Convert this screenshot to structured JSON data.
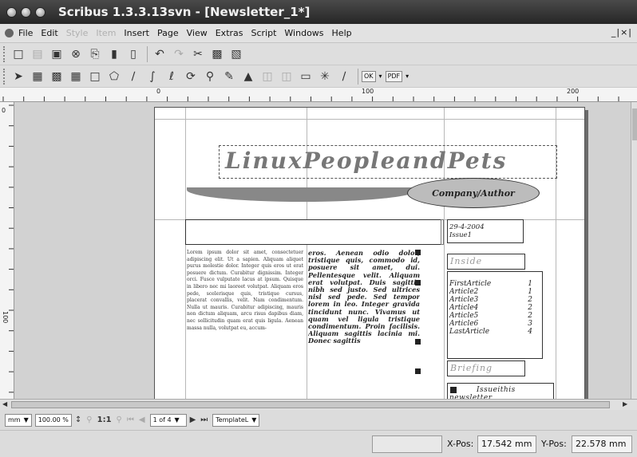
{
  "window": {
    "title": "Scribus 1.3.3.13svn - [Newsletter_1*]"
  },
  "menu": {
    "items": [
      {
        "label": "File",
        "enabled": true
      },
      {
        "label": "Edit",
        "enabled": true
      },
      {
        "label": "Style",
        "enabled": false
      },
      {
        "label": "Item",
        "enabled": false
      },
      {
        "label": "Insert",
        "enabled": true
      },
      {
        "label": "Page",
        "enabled": true
      },
      {
        "label": "View",
        "enabled": true
      },
      {
        "label": "Extras",
        "enabled": true
      },
      {
        "label": "Script",
        "enabled": true
      },
      {
        "label": "Windows",
        "enabled": true
      },
      {
        "label": "Help",
        "enabled": true
      }
    ],
    "mdi_controls": "_|×|"
  },
  "toolbar1": {
    "icons": [
      "new-document-icon",
      "open-icon",
      "save-icon",
      "close-icon",
      "print-icon",
      "preflight-icon",
      "pdf-icon",
      "undo-icon",
      "redo-icon",
      "cut-icon",
      "copy-icon",
      "paste-icon"
    ]
  },
  "toolbar2": {
    "icons": [
      "select-icon",
      "text-frame-icon",
      "image-frame-icon",
      "table-icon",
      "shape-icon",
      "polygon-icon",
      "line-icon",
      "bezier-icon",
      "freehand-icon",
      "rotate-icon",
      "zoom-icon",
      "edit-text-icon",
      "story-editor-icon",
      "link-frames-icon",
      "unlink-frames-icon",
      "measure-icon",
      "copy-properties-icon",
      "eyedropper-icon"
    ],
    "pdf_tools": [
      "OK",
      "PDF"
    ]
  },
  "ruler": {
    "h_labels": [
      "0",
      "100",
      "200"
    ],
    "v_labels": [
      "0",
      "100"
    ]
  },
  "document": {
    "headline": "LinuxPeopleandPets",
    "oval_label": "Company/Author",
    "date_box": [
      "29-4-2004",
      "Issue1"
    ],
    "body_col1": "Lorem ipsum dolor sit amet, consectetuer adipiscing elit. Ut a sapien. Aliquam aliquet purus molestie dolor. Integer quis eros ut erat posuere dictum. Curabitur dignissim. Integer orci. Fusce vulputate lacus at ipsum. Quisque in libero nec mi laoreet volutpat. Aliquam eros pede, scelerisque quis, tristique cursus, placerat convallis, velit. Nam condimentum. Nulla ut mauris. Curabitur adipiscing, mauris non dictum aliquam, arcu risus dapibus diam, nec sollicitudin quam erat quis ligula. Aenean massa nulla, volutpat eu, accum-",
    "body_col2": "eros. Aenean odio dolor, tristique quis, commodo id, posuere sit amet, dui. Pellentesque velit. Aliquam erat volutpat. Duis sagittis nibh sed justo. Sed ultrices nisl sed pede. Sed tempor lorem in leo. Integer gravida tincidunt nunc. Vivamus ut quam vel ligula tristique condimentum. Proin facilisis. Aliquam sagittis lacinia mi. Donec sagittis",
    "inside_title": "Inside",
    "toc": [
      {
        "label": "FirstArticle",
        "page": "1"
      },
      {
        "label": "Article2",
        "page": "1"
      },
      {
        "label": "Article3",
        "page": "2"
      },
      {
        "label": "Article4",
        "page": "2"
      },
      {
        "label": "Article5",
        "page": "2"
      },
      {
        "label": "Article6",
        "page": "3"
      },
      {
        "label": "LastArticle",
        "page": "4"
      }
    ],
    "briefing_title": "Briefing",
    "briefing_text": [
      "Issueithis",
      "newsletter"
    ]
  },
  "navbar": {
    "unit": "mm",
    "zoom": "100.00 %",
    "zoom_1to1": "1:1",
    "page": "1 of 4",
    "layer": "TemplateL"
  },
  "status": {
    "xpos_label": "X-Pos:",
    "xpos_value": "17.542 mm",
    "ypos_label": "Y-Pos:",
    "ypos_value": "22.578 mm"
  }
}
